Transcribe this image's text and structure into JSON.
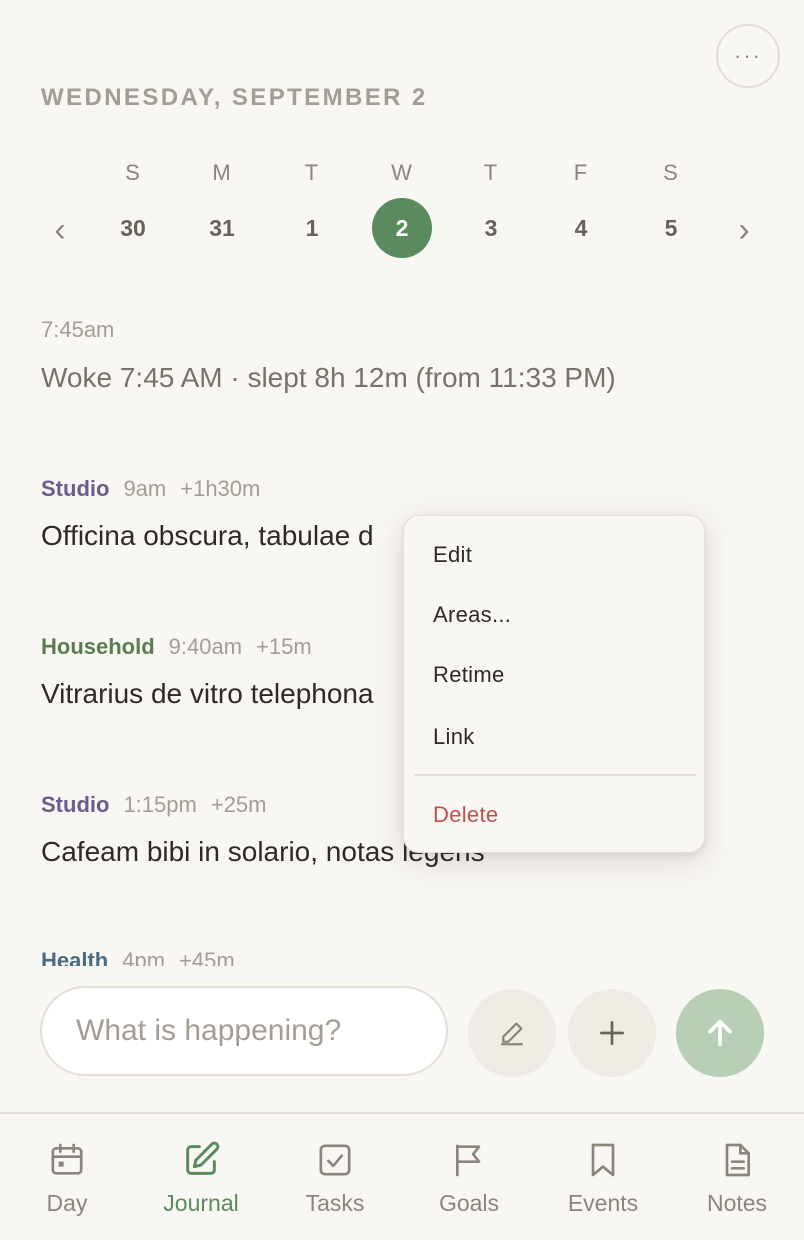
{
  "header": {
    "date_title": "WEDNESDAY, SEPTEMBER 2",
    "more_label": "···"
  },
  "week": {
    "prev_arrow": "‹",
    "next_arrow": "›",
    "days": [
      {
        "dow": "S",
        "num": "30"
      },
      {
        "dow": "M",
        "num": "31"
      },
      {
        "dow": "T",
        "num": "1"
      },
      {
        "dow": "W",
        "num": "2",
        "selected": true
      },
      {
        "dow": "T",
        "num": "3"
      },
      {
        "dow": "F",
        "num": "4"
      },
      {
        "dow": "S",
        "num": "5"
      }
    ],
    "selected_color": "#5a8a5e"
  },
  "entries": {
    "sleep": {
      "time": "7:45am",
      "text": "Woke 7:45 AM · slept 8h 12m (from 11:33 PM)"
    },
    "e1": {
      "area": "Studio",
      "area_color": "#6b5b8e",
      "time": "9am",
      "duration": "+1h30m",
      "text": "Officina obscura, tabulae d"
    },
    "e2": {
      "area": "Household",
      "area_color": "#5a7d4f",
      "time": "9:40am",
      "duration": "+15m",
      "text": "Vitrarius de vitro telephona"
    },
    "e3": {
      "area": "Studio",
      "area_color": "#6b5b8e",
      "time": "1:15pm",
      "duration": "+25m",
      "text": "Cafeam bibi in solario, notas legens"
    },
    "e4": {
      "area": "Health",
      "area_color": "#4a6b82",
      "time": "4pm",
      "duration": "+45m"
    }
  },
  "context_menu": {
    "edit": "Edit",
    "areas": "Areas...",
    "retime": "Retime",
    "link": "Link",
    "delete": "Delete",
    "delete_color": "#bf504b"
  },
  "composer": {
    "placeholder": "What is happening?",
    "value": ""
  },
  "actions": {
    "edit_icon": "pencil-icon",
    "add_icon": "plus-icon",
    "send_icon": "arrow-up-icon"
  },
  "tabs": [
    {
      "label": "Day",
      "icon": "calendar-icon"
    },
    {
      "label": "Journal",
      "icon": "edit-square-icon",
      "active": true
    },
    {
      "label": "Tasks",
      "icon": "checkbox-icon"
    },
    {
      "label": "Goals",
      "icon": "flag-icon"
    },
    {
      "label": "Events",
      "icon": "bookmark-icon"
    },
    {
      "label": "Notes",
      "icon": "document-icon"
    }
  ]
}
